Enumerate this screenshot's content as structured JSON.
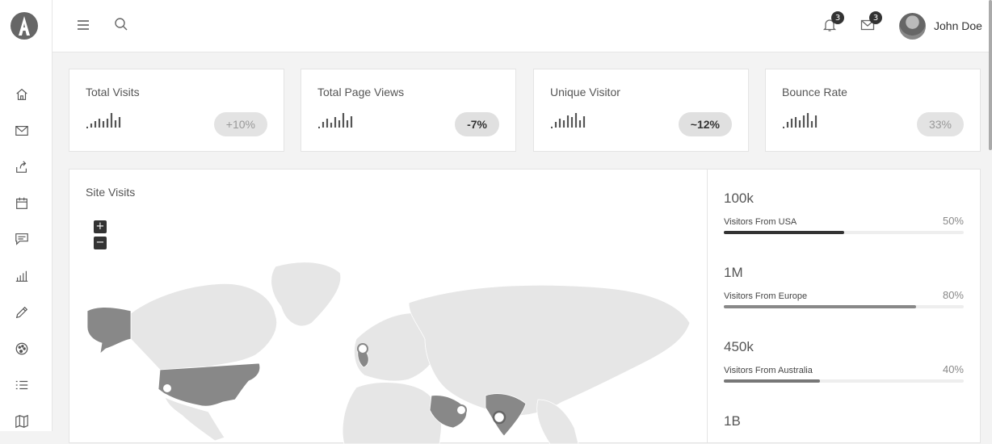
{
  "header": {
    "user_name": "John Doe",
    "notifications_count": "3",
    "messages_count": "3"
  },
  "sidebar": {
    "items": [
      {
        "icon": "home-icon"
      },
      {
        "icon": "mail-icon"
      },
      {
        "icon": "share-icon"
      },
      {
        "icon": "calendar-icon"
      },
      {
        "icon": "chat-icon"
      },
      {
        "icon": "bar-chart-icon"
      },
      {
        "icon": "pencil-icon"
      },
      {
        "icon": "palette-icon"
      },
      {
        "icon": "list-icon"
      },
      {
        "icon": "map-icon"
      }
    ]
  },
  "stats": [
    {
      "title": "Total Visits",
      "change": "+10%"
    },
    {
      "title": "Total Page Views",
      "change": "-7%"
    },
    {
      "title": "Unique Visitor",
      "change": "~12%"
    },
    {
      "title": "Bounce Rate",
      "change": "33%"
    }
  ],
  "map": {
    "title": "Site Visits",
    "zoom_in": "+",
    "zoom_out": "−"
  },
  "visitors": [
    {
      "amount": "100k",
      "label": "Visitors From USA",
      "percent": "50%",
      "fill": 0.5,
      "color": "#333333"
    },
    {
      "amount": "1M",
      "label": "Visitors From Europe",
      "percent": "80%",
      "fill": 0.8,
      "color": "#888888"
    },
    {
      "amount": "450k",
      "label": "Visitors From Australia",
      "percent": "40%",
      "fill": 0.4,
      "color": "#777777"
    },
    {
      "amount": "1B",
      "label": "",
      "percent": "",
      "fill": 0,
      "color": "#777777"
    }
  ]
}
